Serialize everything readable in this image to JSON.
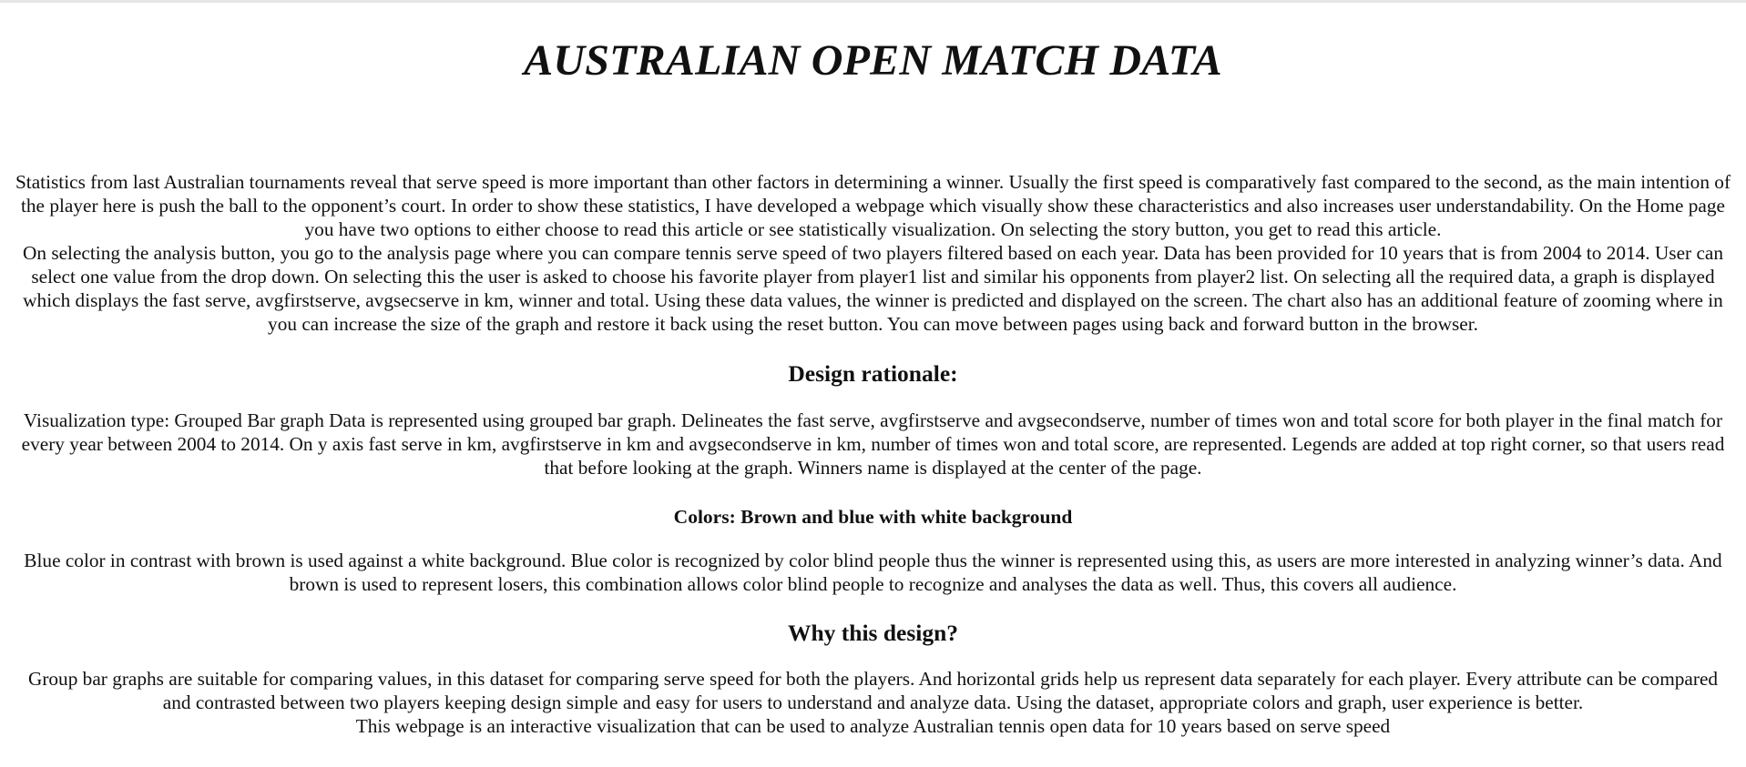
{
  "page": {
    "title": "AUSTRALIAN OPEN MATCH DATA"
  },
  "intro": {
    "paragraph1": "Statistics from last Australian tournaments reveal that serve speed is more important than other factors in determining a winner. Usually the first speed is comparatively fast compared to the second, as the main intention of the player here is push the ball to the opponent’s court. In order to show these statistics, I have developed a webpage which visually show these characteristics and also increases user understandability. On the Home page you have two options to either choose to read this article or see statistically visualization. On selecting the story button, you get to read this article.",
    "paragraph2": "On selecting the analysis button, you go to the analysis page where you can compare tennis serve speed of two players filtered based on each year. Data has been provided for 10 years that is from 2004 to 2014. User can select one value from the drop down. On selecting this the user is asked to choose his favorite player from player1 list and similar his opponents from player2 list. On selecting all the required data, a graph is displayed which displays the fast serve, avgfirstserve, avgsecserve in km, winner and total. Using these data values, the winner is predicted and displayed on the screen. The chart also has an additional feature of zooming where in you can increase the size of the graph and restore it back using the reset button. You can move between pages using back and forward button in the browser."
  },
  "design_rationale": {
    "heading": "Design rationale:",
    "text": "Visualization type: Grouped Bar graph Data is represented using grouped bar graph. Delineates the fast serve, avgfirstserve and avgsecondserve, number of times won and total score for both player in the final match for every year between 2004 to 2014. On y axis fast serve in km, avgfirstserve in km and avgsecondserve in km, number of times won and total score, are represented. Legends are added at top right corner, so that users read that before looking at the graph. Winners name is displayed at the center of the page."
  },
  "colors": {
    "heading": "Colors: Brown and blue with white background",
    "text": "Blue color in contrast with brown is used against a white background. Blue color is recognized by color blind people thus the winner is represented using this, as users are more interested in analyzing winner’s data. And brown is used to represent losers, this combination allows color blind people to recognize and analyses the data as well. Thus, this covers all audience."
  },
  "why": {
    "heading": "Why this design?",
    "text": "Group bar graphs are suitable for comparing values, in this dataset for comparing serve speed for both the players. And horizontal grids help us represent data separately for each player. Every attribute can be compared and contrasted between two players keeping design simple and easy for users to understand and analyze data. Using the dataset, appropriate colors and graph, user experience is better.",
    "closing": "This webpage is an interactive visualization that can be used to analyze Australian tennis open data for 10 years based on serve speed"
  }
}
